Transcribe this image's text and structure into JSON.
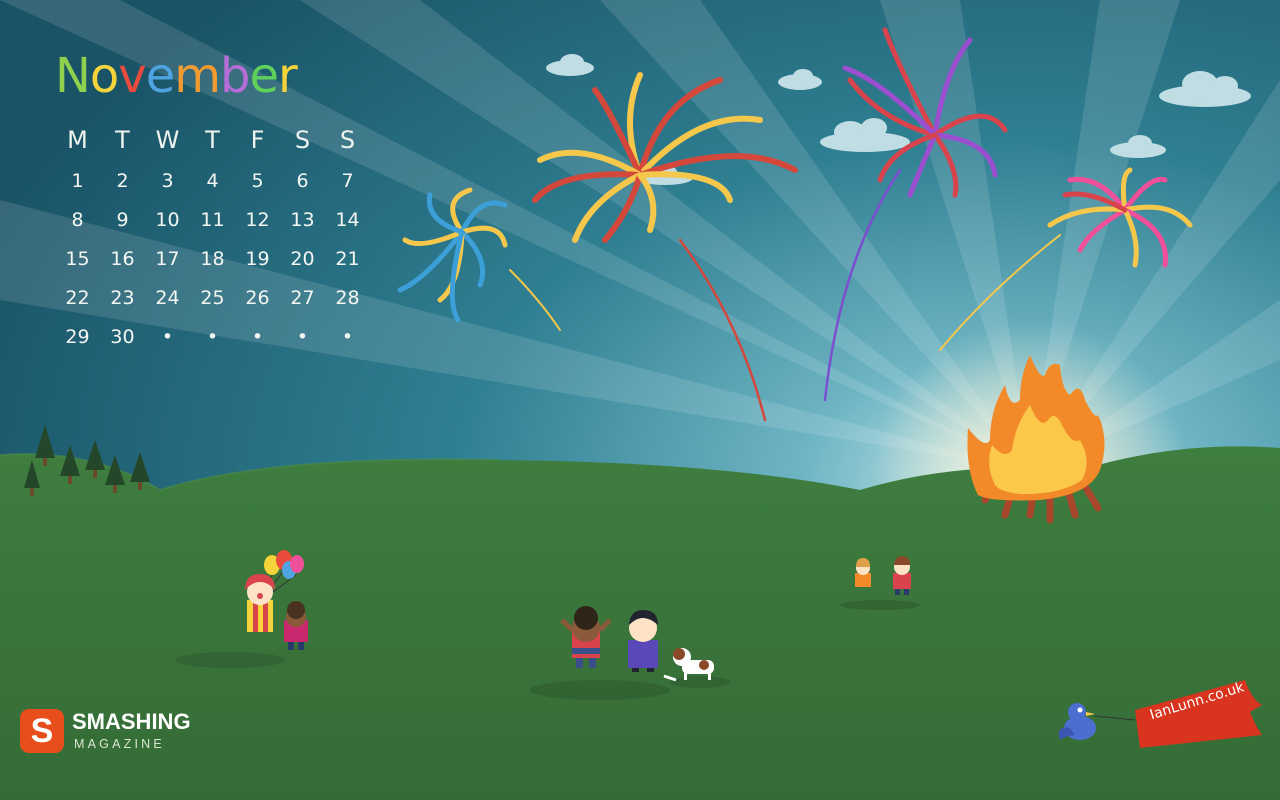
{
  "calendar": {
    "month": "November",
    "month_colors": [
      "#8fd14f",
      "#f5d33b",
      "#e94b3c",
      "#4fa3e0",
      "#f29b30",
      "#b46cd6",
      "#5fd05a",
      "#f5d33b"
    ],
    "weekdays": [
      "M",
      "T",
      "W",
      "T",
      "F",
      "S",
      "S"
    ],
    "days": [
      "1",
      "2",
      "3",
      "4",
      "5",
      "6",
      "7",
      "8",
      "9",
      "10",
      "11",
      "12",
      "13",
      "14",
      "15",
      "16",
      "17",
      "18",
      "19",
      "20",
      "21",
      "22",
      "23",
      "24",
      "25",
      "26",
      "27",
      "28",
      "29",
      "30",
      "•",
      "•",
      "•",
      "•",
      "•"
    ]
  },
  "logo": {
    "mark": "S",
    "line1": "SMASHING",
    "line2": "MAGAZINE"
  },
  "banner": {
    "text": "IanLunn.co.uk"
  },
  "colors": {
    "sky": "#1f6b7c",
    "grass": "#3a7a3c",
    "fire": "#f6a23a",
    "accent": "#e84e1b"
  }
}
